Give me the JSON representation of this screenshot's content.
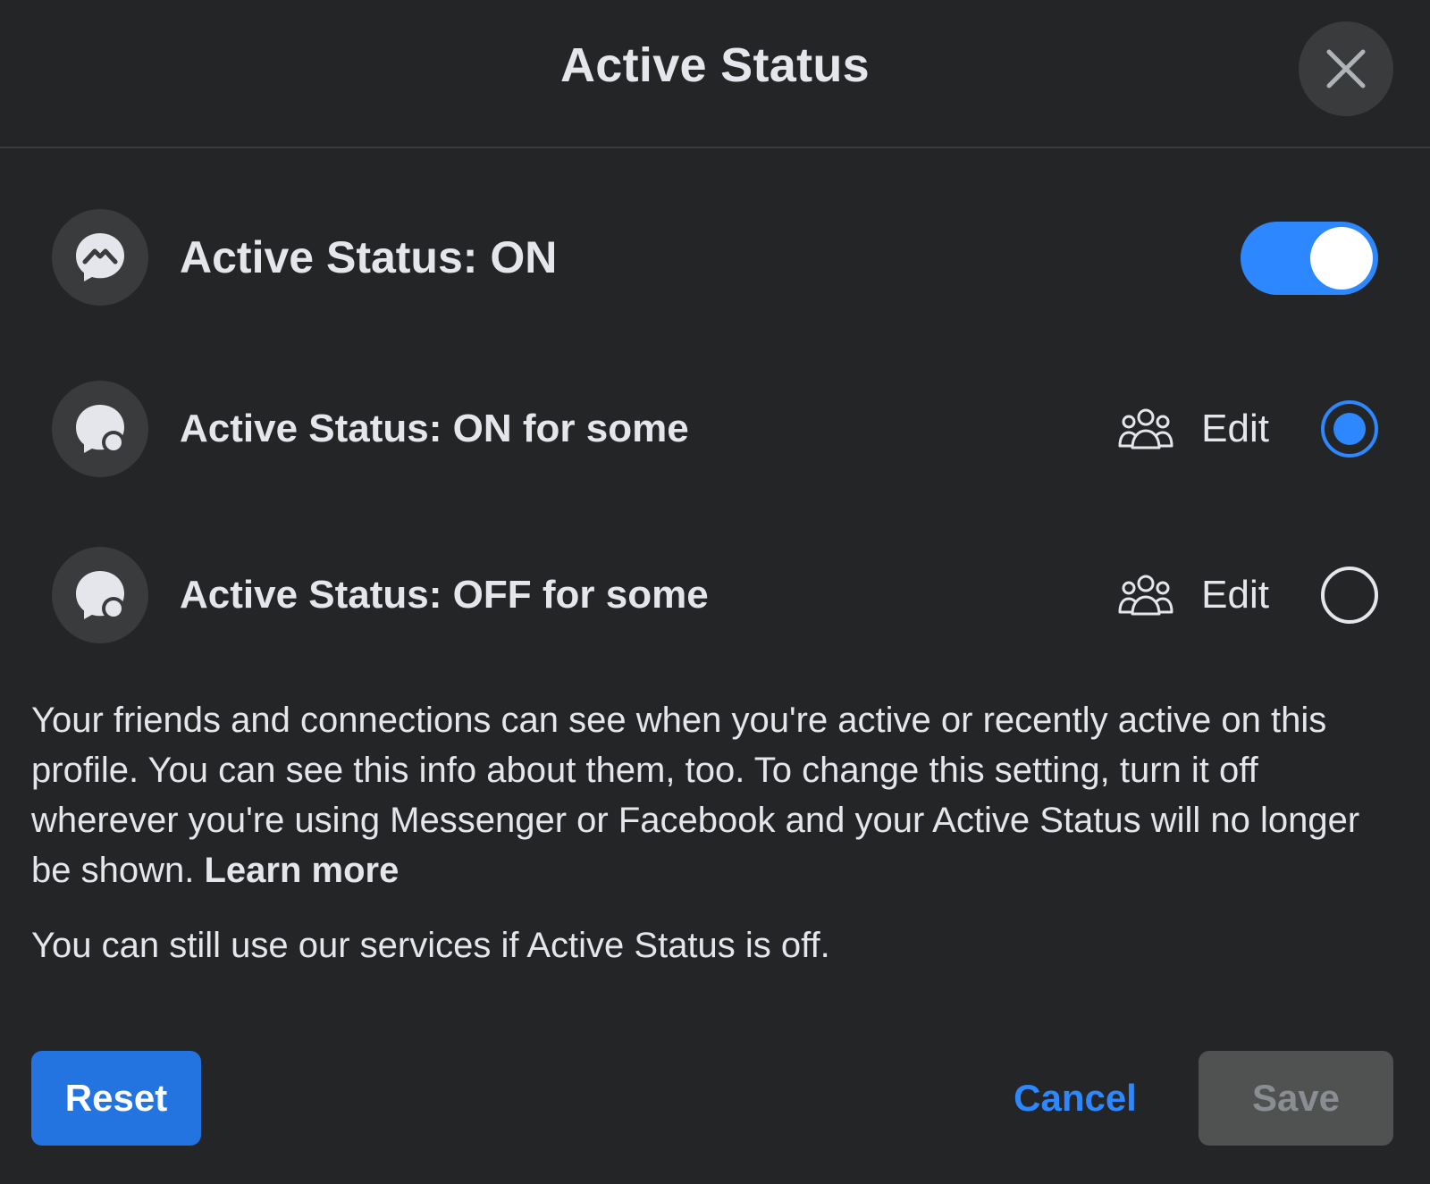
{
  "dialog": {
    "title": "Active Status",
    "close_icon": "close-icon"
  },
  "options": [
    {
      "label": "Active Status: ON",
      "icon": "messenger-icon",
      "control": "toggle",
      "toggle_on": true
    },
    {
      "label": "Active Status: ON for some",
      "icon": "partial-status-icon",
      "action_icon": "people-icon",
      "edit_label": "Edit",
      "control": "radio",
      "selected": true
    },
    {
      "label": "Active Status: OFF for some",
      "icon": "partial-status-icon",
      "action_icon": "people-icon",
      "edit_label": "Edit",
      "control": "radio",
      "selected": false
    }
  ],
  "description": {
    "text": "Your friends and connections can see when you're active or recently active on this profile. You can see this info about them, too. To change this setting, turn it off wherever you're using Messenger or Facebook and your Active Status will no longer be shown. ",
    "link": "Learn more"
  },
  "note": "You can still use our services if Active Status is off.",
  "footer": {
    "reset_label": "Reset",
    "cancel_label": "Cancel",
    "save_label": "Save"
  },
  "colors": {
    "background": "#242526",
    "surface": "#3a3b3c",
    "accent": "#2d88ff",
    "primary_button": "#2374e1",
    "disabled_button": "#505151",
    "text": "#e4e6eb"
  }
}
